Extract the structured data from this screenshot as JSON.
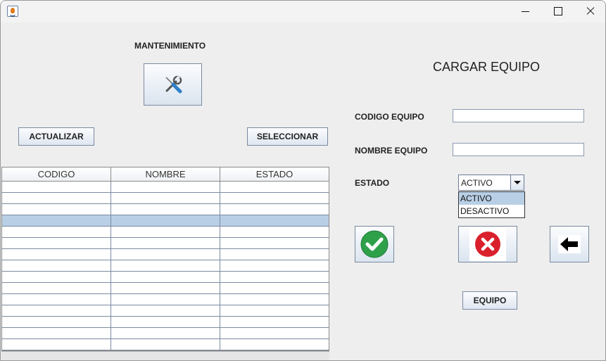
{
  "window": {
    "title": "",
    "controls": [
      "minimize-icon",
      "maximize-icon",
      "close-icon"
    ]
  },
  "maintenance": {
    "label": "MANTENIMIENTO",
    "icon": "tools-icon"
  },
  "left_buttons": {
    "refresh": "ACTUALIZAR",
    "select": "SELECCIONAR"
  },
  "table": {
    "columns": [
      "CODIGO",
      "NOMBRE",
      "ESTADO"
    ],
    "row_count": 15,
    "selected_row": 3,
    "rows": []
  },
  "form": {
    "title": "CARGAR EQUIPO",
    "code_label": "CODIGO EQUIPO",
    "code_value": "",
    "name_label": "NOMBRE EQUIPO",
    "name_value": "",
    "status_label": "ESTADO",
    "status_selected": "ACTIVO",
    "status_options": [
      "ACTIVO",
      "DESACTIVO"
    ]
  },
  "actions": {
    "confirm_icon": "check-icon",
    "cancel_icon": "cancel-icon",
    "back_icon": "arrow-left-icon",
    "equipo_button": "EQUIPO"
  },
  "colors": {
    "selection": "#b8cfe5",
    "confirm_green": "#2ea04a",
    "cancel_red": "#d9202c",
    "button_border": "#7a8aa0"
  }
}
